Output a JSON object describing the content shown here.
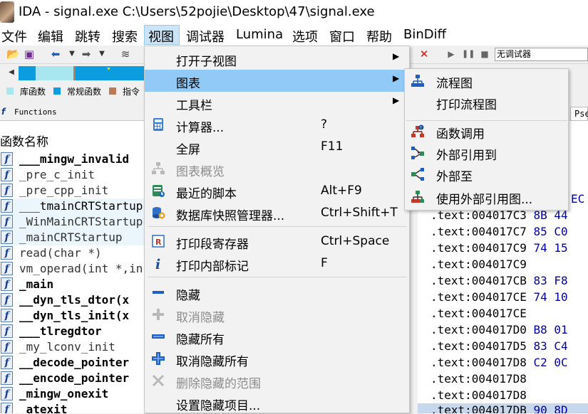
{
  "window": {
    "title": "IDA - signal.exe C:\\Users\\52pojie\\Desktop\\47\\signal.exe"
  },
  "menubar": {
    "items": [
      {
        "label": "文件"
      },
      {
        "label": "编辑"
      },
      {
        "label": "跳转"
      },
      {
        "label": "搜索"
      },
      {
        "label": "视图"
      },
      {
        "label": "调试器"
      },
      {
        "label": "Lumina"
      },
      {
        "label": "选项"
      },
      {
        "label": "窗口"
      },
      {
        "label": "帮助"
      },
      {
        "label": "BinDiff"
      }
    ]
  },
  "toolbar": {
    "debugger_select": "无调试器"
  },
  "legend": {
    "items": [
      {
        "label": "库函数",
        "color": "#a8e6f0"
      },
      {
        "label": "常规函数",
        "color": "#0b9de0"
      },
      {
        "label": "指令",
        "color": "#b97a57"
      }
    ]
  },
  "functions_panel": {
    "tab_label": "Functions",
    "header": "函数名称",
    "rows": [
      {
        "name": "___mingw_invalid"
      },
      {
        "name": "_pre_c_init"
      },
      {
        "name": "_pre_cpp_init"
      },
      {
        "name": "___tmainCRTStartup"
      },
      {
        "name": "_WinMainCRTStartup"
      },
      {
        "name": "_mainCRTStartup"
      },
      {
        "name": "read(char *)"
      },
      {
        "name": "vm_operad(int *,in"
      },
      {
        "name": "_main"
      },
      {
        "name": "__dyn_tls_dtor(x"
      },
      {
        "name": "__dyn_tls_init(x"
      },
      {
        "name": "___tlregdtor"
      },
      {
        "name": "_my_lconv_init"
      },
      {
        "name": "__decode_pointer"
      },
      {
        "name": "__encode_pointer"
      },
      {
        "name": "_mingw_onexit"
      },
      {
        "name": "_atexit"
      }
    ]
  },
  "view_menu": {
    "items": [
      {
        "label": "打开子视图",
        "shortcut": "",
        "submenu": true,
        "disabled": false,
        "icon": "none"
      },
      {
        "label": "图表",
        "shortcut": "",
        "submenu": true,
        "disabled": false,
        "icon": "none"
      },
      {
        "label": "工具栏",
        "shortcut": "",
        "submenu": true,
        "disabled": false,
        "icon": "none"
      },
      {
        "label": "计算器...",
        "shortcut": "?",
        "submenu": false,
        "disabled": false,
        "icon": "calculator-icon"
      },
      {
        "label": "全屏",
        "shortcut": "F11",
        "submenu": false,
        "disabled": false,
        "icon": "none"
      },
      {
        "label": "图表概览",
        "shortcut": "",
        "submenu": false,
        "disabled": true,
        "icon": "graph-overview-icon"
      },
      {
        "label": "最近的脚本",
        "shortcut": "Alt+F9",
        "submenu": false,
        "disabled": false,
        "icon": "script-icon"
      },
      {
        "label": "数据库快照管理器...",
        "shortcut": "Ctrl+Shift+T",
        "submenu": false,
        "disabled": false,
        "icon": "snapshot-icon"
      },
      {
        "label": "打印段寄存器",
        "shortcut": "Ctrl+Space",
        "submenu": false,
        "disabled": false,
        "icon": "segment-register-icon"
      },
      {
        "label": "打印内部标记",
        "shortcut": "F",
        "submenu": false,
        "disabled": false,
        "icon": "info-icon"
      },
      {
        "label": "隐藏",
        "shortcut": "",
        "submenu": false,
        "disabled": false,
        "icon": "hide-icon"
      },
      {
        "label": "取消隐藏",
        "shortcut": "",
        "submenu": false,
        "disabled": true,
        "icon": "unhide-icon"
      },
      {
        "label": "隐藏所有",
        "shortcut": "",
        "submenu": false,
        "disabled": false,
        "icon": "hide-all-icon"
      },
      {
        "label": "取消隐藏所有",
        "shortcut": "",
        "submenu": false,
        "disabled": false,
        "icon": "unhide-all-icon"
      },
      {
        "label": "删除隐藏的范围",
        "shortcut": "",
        "submenu": false,
        "disabled": true,
        "icon": "delete-hidden-icon"
      },
      {
        "label": "设置隐藏项目...",
        "shortcut": "",
        "submenu": false,
        "disabled": false,
        "icon": "none"
      }
    ]
  },
  "graphs_submenu": {
    "items": [
      {
        "label": "流程图",
        "icon": "flow-chart-icon"
      },
      {
        "label": "打印流程图",
        "icon": "none"
      },
      {
        "label": "函数调用",
        "icon": "function-calls-icon"
      },
      {
        "label": "外部引用到",
        "icon": "xrefs-to-icon"
      },
      {
        "label": "外部至",
        "icon": "xrefs-from-icon"
      },
      {
        "label": "使用外部引用图...",
        "icon": "user-xref-graph-icon"
      }
    ]
  },
  "code_pane": {
    "tab_label": "Pse",
    "partial_bytes": "EC",
    "lines": [
      {
        "addr": ".text:004017C3",
        "bytes": "8B 44"
      },
      {
        "addr": ".text:004017C7",
        "bytes": "85 C0"
      },
      {
        "addr": ".text:004017C9",
        "bytes": "74 15"
      },
      {
        "addr": ".text:004017C9",
        "bytes": ""
      },
      {
        "addr": ".text:004017CB",
        "bytes": "83 F8"
      },
      {
        "addr": ".text:004017CE",
        "bytes": "74 10"
      },
      {
        "addr": ".text:004017CE",
        "bytes": ""
      },
      {
        "addr": ".text:004017D0",
        "bytes": "B8 01"
      },
      {
        "addr": ".text:004017D5",
        "bytes": "83 C4"
      },
      {
        "addr": ".text:004017D8",
        "bytes": "C2 0C"
      },
      {
        "addr": ".text:004017D8",
        "bytes": ""
      },
      {
        "addr": ".text:004017D8",
        "bytes": ""
      },
      {
        "addr": ".text:004017DB",
        "bytes": "90 8D"
      }
    ]
  }
}
